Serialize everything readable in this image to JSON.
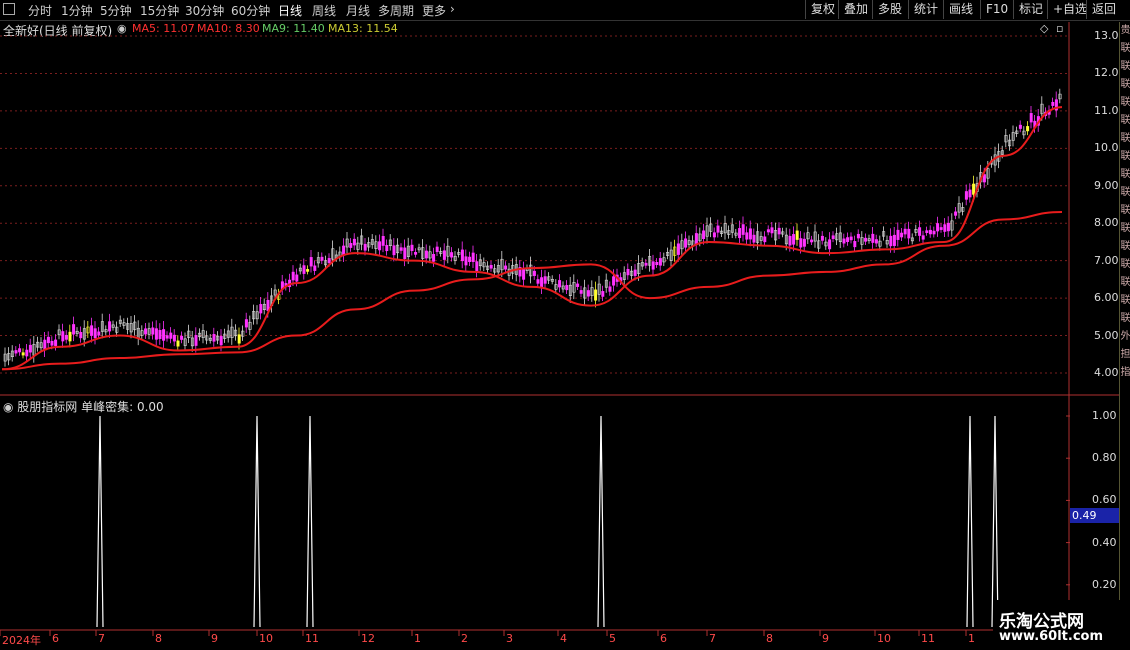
{
  "toolbar": {
    "periods": [
      "分时",
      "1分钟",
      "5分钟",
      "15分钟",
      "30分钟",
      "60分钟",
      "日线",
      "周线",
      "月线",
      "多周期",
      "更多"
    ],
    "active_period": "日线",
    "buttons": [
      "复权",
      "叠加",
      "多股",
      "统计",
      "画线",
      "F10",
      "标记",
      "+自选",
      "返回"
    ]
  },
  "main_chart": {
    "stock_title": "全新好(日线 前复权)",
    "ma_labels": [
      {
        "text": "MA5: 11.07",
        "color": "#ff3030"
      },
      {
        "text": "MA10: 8.30",
        "color": "#ff3030"
      },
      {
        "text": "MA9: 11.40",
        "color": "#66cc66"
      },
      {
        "text": "MA13: 11.54",
        "color": "#cccc33"
      }
    ],
    "price_axis": [
      "13.00",
      "12.00",
      "11.00",
      "10.00",
      "9.00",
      "8.00",
      "7.00",
      "6.00",
      "5.00",
      "4.00"
    ]
  },
  "indicator": {
    "title": "股朋指标网  单峰密集: 0.00",
    "axis": [
      "1.00",
      "0.80",
      "0.60",
      "0.40",
      "0.20"
    ],
    "cursor_value": "0.49"
  },
  "dates": [
    "2024年",
    "6",
    "7",
    "8",
    "9",
    "10",
    "11",
    "12",
    "1",
    "2",
    "3",
    "4",
    "5",
    "6",
    "7",
    "8",
    "9",
    "10",
    "11",
    "1"
  ],
  "right_strip_chars": [
    "贵",
    "联",
    "联",
    "联",
    "联",
    "联",
    "联",
    "联",
    "联",
    "联",
    "联",
    "联",
    "联",
    "联",
    "联",
    "联",
    "联",
    "外",
    "担",
    "指"
  ],
  "watermark": {
    "logo": "乐淘公式网",
    "url": "www.60lt.com"
  },
  "chart_data": {
    "type": "line",
    "title": "",
    "price_range": [
      4.0,
      13.0
    ],
    "ma_long": {
      "name": "",
      "values": [
        4.1,
        4.25,
        4.4,
        4.5,
        4.55,
        5.0,
        5.7,
        6.2,
        6.5,
        6.8,
        6.9,
        6.0,
        6.3,
        6.6,
        6.7,
        6.9,
        7.4,
        8.1,
        8.3
      ]
    },
    "ma_mid": {
      "name": "",
      "values": [
        4.1,
        4.7,
        5.0,
        4.6,
        4.7,
        6.4,
        7.2,
        7.0,
        6.7,
        6.3,
        5.8,
        6.6,
        7.5,
        7.4,
        7.2,
        7.3,
        7.5,
        9.8,
        11.1
      ]
    },
    "signal_peaks_x": [
      "7",
      "10",
      "11",
      "4",
      "1",
      "1"
    ],
    "signal_values": [
      1.0,
      1.0,
      1.0,
      1.0,
      1.0,
      1.0
    ],
    "signal_axis_range": [
      0,
      1.0
    ]
  }
}
